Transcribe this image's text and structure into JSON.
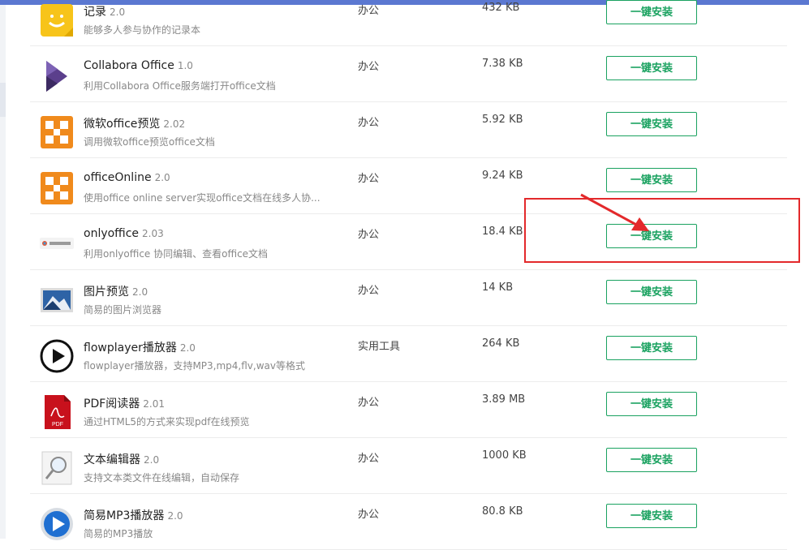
{
  "install_label": "一键安装",
  "apps": [
    {
      "name": "记录",
      "version": "2.0",
      "desc": "能够多人参与协作的记录本",
      "category": "办公",
      "size": "432 KB",
      "icon": "notepad-smile-icon"
    },
    {
      "name": "Collabora Office",
      "version": "1.0",
      "desc": "利用Collabora Office服务端打开office文档",
      "category": "办公",
      "size": "7.38 KB",
      "icon": "collabora-logo-icon"
    },
    {
      "name": "微软office预览",
      "version": "2.02",
      "desc": "调用微软office预览office文档",
      "category": "办公",
      "size": "5.92 KB",
      "icon": "office-logo-icon"
    },
    {
      "name": "officeOnline",
      "version": "2.0",
      "desc": "使用office online server实现office文档在线多人协...",
      "category": "办公",
      "size": "9.24 KB",
      "icon": "office-logo-icon"
    },
    {
      "name": "onlyoffice",
      "version": "2.03",
      "desc": "利用onlyoffice 协同编辑、查看office文档",
      "category": "办公",
      "size": "18.4 KB",
      "icon": "onlyoffice-logo-icon"
    },
    {
      "name": "图片预览",
      "version": "2.0",
      "desc": "简易的图片浏览器",
      "category": "办公",
      "size": "14 KB",
      "icon": "image-mountain-icon"
    },
    {
      "name": "flowplayer播放器",
      "version": "2.0",
      "desc": "flowplayer播放器，支持MP3,mp4,flv,wav等格式",
      "category": "实用工具",
      "size": "264 KB",
      "icon": "play-circle-icon"
    },
    {
      "name": "PDF阅读器",
      "version": "2.01",
      "desc": "通过HTML5的方式来实现pdf在线预览",
      "category": "办公",
      "size": "3.89 MB",
      "icon": "pdf-file-icon"
    },
    {
      "name": "文本编辑器",
      "version": "2.0",
      "desc": "支持文本类文件在线编辑，自动保存",
      "category": "办公",
      "size": "1000 KB",
      "icon": "magnifier-doc-icon"
    },
    {
      "name": "简易MP3播放器",
      "version": "2.0",
      "desc": "简易的MP3播放",
      "category": "办公",
      "size": "80.8 KB",
      "icon": "blue-play-button-icon"
    }
  ],
  "colors": {
    "accent": "#1aa260",
    "highlight": "#e3292b",
    "topbar": "#5b78d1"
  }
}
